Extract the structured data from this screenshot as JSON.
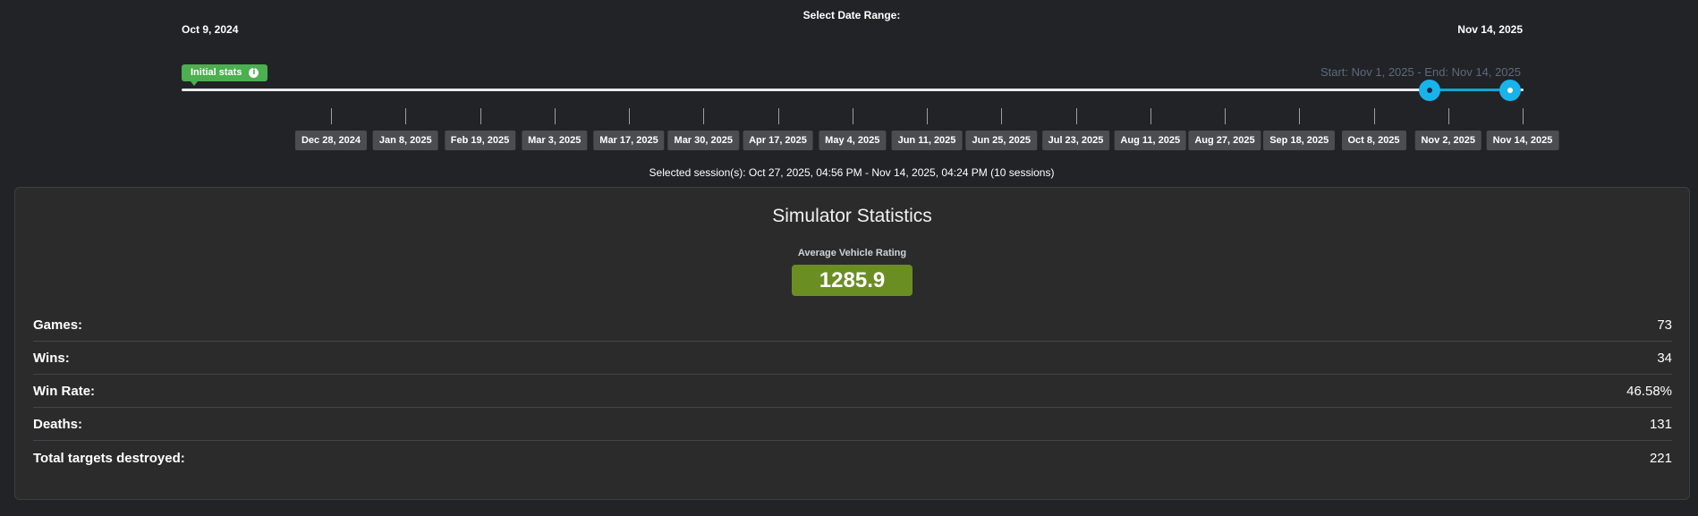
{
  "range": {
    "label": "Select Date Range:",
    "start_date": "Oct 9, 2024",
    "end_date": "Nov 14, 2025",
    "summary": "Start: Nov 1, 2025 - End: Nov 14, 2025",
    "initial_stats_label": "Initial stats",
    "selected_start_fraction": 0.93,
    "selected_end_fraction": 0.99
  },
  "ticks": [
    "Dec 28, 2024",
    "Jan 8, 2025",
    "Feb 19, 2025",
    "Mar 3, 2025",
    "Mar 17, 2025",
    "Mar 30, 2025",
    "Apr 17, 2025",
    "May 4, 2025",
    "Jun 11, 2025",
    "Jun 25, 2025",
    "Jul 23, 2025",
    "Aug 11, 2025",
    "Aug 27, 2025",
    "Sep 18, 2025",
    "Oct 8, 2025",
    "Nov 2, 2025",
    "Nov 14, 2025"
  ],
  "session_summary": "Selected session(s): Oct 27, 2025, 04:56 PM - Nov 14, 2025, 04:24 PM (10 sessions)",
  "stats": {
    "title": "Simulator Statistics",
    "rating_label": "Average Vehicle Rating",
    "rating_value": "1285.9",
    "rows": [
      {
        "label": "Games:",
        "value": "73"
      },
      {
        "label": "Wins:",
        "value": "34"
      },
      {
        "label": "Win Rate:",
        "value": "46.58%"
      },
      {
        "label": "Deaths:",
        "value": "131"
      },
      {
        "label": "Total targets destroyed:",
        "value": "221"
      }
    ]
  },
  "colors": {
    "background": "#212327",
    "accent": "#19b3ec",
    "initial_stats": "#4caf50",
    "rating": "#6b8e23"
  },
  "icons": {
    "initial_stats_info": "info-icon"
  }
}
